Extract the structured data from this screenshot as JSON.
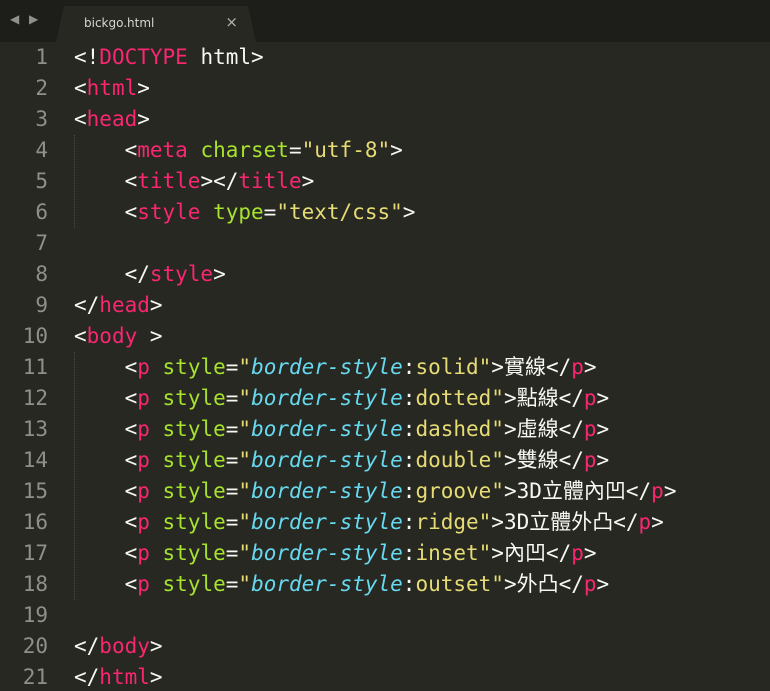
{
  "tab": {
    "nav_label": "◀ ▶",
    "title": "bickgo.html",
    "close": "×"
  },
  "lines": [
    {
      "num": "1",
      "tokens": [
        [
          "d",
          "<!"
        ],
        [
          "t",
          "DOCTYPE"
        ],
        [
          "d",
          " html>"
        ]
      ]
    },
    {
      "num": "2",
      "tokens": [
        [
          "d",
          "<"
        ],
        [
          "t",
          "html"
        ],
        [
          "d",
          ">"
        ]
      ]
    },
    {
      "num": "3",
      "tokens": [
        [
          "d",
          "<"
        ],
        [
          "t",
          "head"
        ],
        [
          "d",
          ">"
        ]
      ]
    },
    {
      "num": "4",
      "tokens": [
        [
          "d",
          "    <"
        ],
        [
          "t",
          "meta"
        ],
        [
          "d",
          " "
        ],
        [
          "a",
          "charset"
        ],
        [
          "d",
          "="
        ],
        [
          "s",
          "\"utf-8\""
        ],
        [
          "d",
          ">"
        ]
      ]
    },
    {
      "num": "5",
      "tokens": [
        [
          "d",
          "    <"
        ],
        [
          "t",
          "title"
        ],
        [
          "d",
          "></"
        ],
        [
          "t",
          "title"
        ],
        [
          "d",
          ">"
        ]
      ]
    },
    {
      "num": "6",
      "tokens": [
        [
          "d",
          "    <"
        ],
        [
          "t",
          "style"
        ],
        [
          "d",
          " "
        ],
        [
          "a",
          "type"
        ],
        [
          "d",
          "="
        ],
        [
          "s",
          "\"text/css\""
        ],
        [
          "d",
          ">"
        ]
      ]
    },
    {
      "num": "7",
      "tokens": []
    },
    {
      "num": "8",
      "tokens": [
        [
          "d",
          "    </"
        ],
        [
          "t",
          "style"
        ],
        [
          "d",
          ">"
        ]
      ]
    },
    {
      "num": "9",
      "tokens": [
        [
          "d",
          "</"
        ],
        [
          "t",
          "head"
        ],
        [
          "d",
          ">"
        ]
      ]
    },
    {
      "num": "10",
      "tokens": [
        [
          "d",
          "<"
        ],
        [
          "t",
          "body"
        ],
        [
          "d",
          " >"
        ]
      ]
    },
    {
      "num": "11",
      "tokens": [
        [
          "d",
          "    <"
        ],
        [
          "t",
          "p"
        ],
        [
          "d",
          " "
        ],
        [
          "a",
          "style"
        ],
        [
          "d",
          "="
        ],
        [
          "s",
          "\""
        ],
        [
          "p",
          "border-style"
        ],
        [
          "d",
          ":"
        ],
        [
          "s",
          "solid\""
        ],
        [
          "d",
          ">實線</"
        ],
        [
          "t",
          "p"
        ],
        [
          "d",
          ">"
        ]
      ]
    },
    {
      "num": "12",
      "tokens": [
        [
          "d",
          "    <"
        ],
        [
          "t",
          "p"
        ],
        [
          "d",
          " "
        ],
        [
          "a",
          "style"
        ],
        [
          "d",
          "="
        ],
        [
          "s",
          "\""
        ],
        [
          "p",
          "border-style"
        ],
        [
          "d",
          ":"
        ],
        [
          "s",
          "dotted\""
        ],
        [
          "d",
          ">點線</"
        ],
        [
          "t",
          "p"
        ],
        [
          "d",
          ">"
        ]
      ]
    },
    {
      "num": "13",
      "tokens": [
        [
          "d",
          "    <"
        ],
        [
          "t",
          "p"
        ],
        [
          "d",
          " "
        ],
        [
          "a",
          "style"
        ],
        [
          "d",
          "="
        ],
        [
          "s",
          "\""
        ],
        [
          "p",
          "border-style"
        ],
        [
          "d",
          ":"
        ],
        [
          "s",
          "dashed\""
        ],
        [
          "d",
          ">虛線</"
        ],
        [
          "t",
          "p"
        ],
        [
          "d",
          ">"
        ]
      ]
    },
    {
      "num": "14",
      "tokens": [
        [
          "d",
          "    <"
        ],
        [
          "t",
          "p"
        ],
        [
          "d",
          " "
        ],
        [
          "a",
          "style"
        ],
        [
          "d",
          "="
        ],
        [
          "s",
          "\""
        ],
        [
          "p",
          "border-style"
        ],
        [
          "d",
          ":"
        ],
        [
          "s",
          "double\""
        ],
        [
          "d",
          ">雙線</"
        ],
        [
          "t",
          "p"
        ],
        [
          "d",
          ">"
        ]
      ]
    },
    {
      "num": "15",
      "tokens": [
        [
          "d",
          "    <"
        ],
        [
          "t",
          "p"
        ],
        [
          "d",
          " "
        ],
        [
          "a",
          "style"
        ],
        [
          "d",
          "="
        ],
        [
          "s",
          "\""
        ],
        [
          "p",
          "border-style"
        ],
        [
          "d",
          ":"
        ],
        [
          "s",
          "groove\""
        ],
        [
          "d",
          ">3D立體內凹</"
        ],
        [
          "t",
          "p"
        ],
        [
          "d",
          ">"
        ]
      ]
    },
    {
      "num": "16",
      "tokens": [
        [
          "d",
          "    <"
        ],
        [
          "t",
          "p"
        ],
        [
          "d",
          " "
        ],
        [
          "a",
          "style"
        ],
        [
          "d",
          "="
        ],
        [
          "s",
          "\""
        ],
        [
          "p",
          "border-style"
        ],
        [
          "d",
          ":"
        ],
        [
          "s",
          "ridge\""
        ],
        [
          "d",
          ">3D立體外凸</"
        ],
        [
          "t",
          "p"
        ],
        [
          "d",
          ">"
        ]
      ]
    },
    {
      "num": "17",
      "tokens": [
        [
          "d",
          "    <"
        ],
        [
          "t",
          "p"
        ],
        [
          "d",
          " "
        ],
        [
          "a",
          "style"
        ],
        [
          "d",
          "="
        ],
        [
          "s",
          "\""
        ],
        [
          "p",
          "border-style"
        ],
        [
          "d",
          ":"
        ],
        [
          "s",
          "inset\""
        ],
        [
          "d",
          ">內凹</"
        ],
        [
          "t",
          "p"
        ],
        [
          "d",
          ">"
        ]
      ]
    },
    {
      "num": "18",
      "tokens": [
        [
          "d",
          "    <"
        ],
        [
          "t",
          "p"
        ],
        [
          "d",
          " "
        ],
        [
          "a",
          "style"
        ],
        [
          "d",
          "="
        ],
        [
          "s",
          "\""
        ],
        [
          "p",
          "border-style"
        ],
        [
          "d",
          ":"
        ],
        [
          "s",
          "outset\""
        ],
        [
          "d",
          ">外凸</"
        ],
        [
          "t",
          "p"
        ],
        [
          "d",
          ">"
        ]
      ]
    },
    {
      "num": "19",
      "tokens": []
    },
    {
      "num": "20",
      "tokens": [
        [
          "d",
          "</"
        ],
        [
          "t",
          "body"
        ],
        [
          "d",
          ">"
        ]
      ]
    },
    {
      "num": "21",
      "tokens": [
        [
          "d",
          "</"
        ],
        [
          "t",
          "html"
        ],
        [
          "d",
          ">"
        ]
      ]
    }
  ],
  "colors": {
    "background": "#272822",
    "tab_bar": "#1d1e19",
    "tag": "#f92672",
    "attribute": "#a6e22e",
    "string": "#e6db74",
    "css_property": "#66d9ef",
    "default_text": "#f8f8f2",
    "line_number": "#8f908a"
  }
}
